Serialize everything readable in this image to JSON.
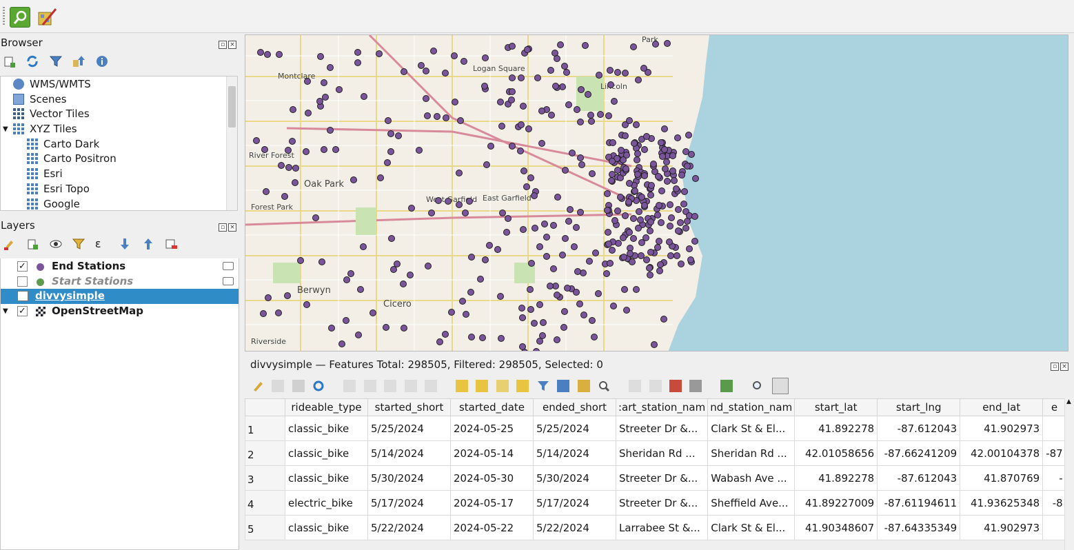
{
  "toolbar": {
    "icons": [
      "identify-icon",
      "digitize-icon"
    ]
  },
  "browser": {
    "title": "Browser",
    "items": [
      {
        "label": "WMS/WMTS",
        "icon": "globe-icon",
        "indent": 0
      },
      {
        "label": "Scenes",
        "icon": "cube-icon",
        "indent": 0
      },
      {
        "label": "Vector Tiles",
        "icon": "grid-icon",
        "indent": 0
      },
      {
        "label": "XYZ Tiles",
        "icon": "grid-icon",
        "indent": 0,
        "expanded": true
      },
      {
        "label": "Carto Dark",
        "icon": "grid-icon",
        "indent": 1
      },
      {
        "label": "Carto Positron",
        "icon": "grid-icon",
        "indent": 1
      },
      {
        "label": "Esri",
        "icon": "grid-icon",
        "indent": 1
      },
      {
        "label": "Esri Topo",
        "icon": "grid-icon",
        "indent": 1
      },
      {
        "label": "Google",
        "icon": "grid-icon",
        "indent": 1
      }
    ]
  },
  "layers": {
    "title": "Layers",
    "items": [
      {
        "label": "End Stations",
        "checked": true,
        "color": "#7b559b"
      },
      {
        "label": "Start Stations",
        "checked": false,
        "color": "#5f9b4f"
      },
      {
        "label": "divvysimple",
        "selected": true
      },
      {
        "label": "OpenStreetMap",
        "checked": true
      }
    ]
  },
  "map": {
    "labels": [
      "Montclare",
      "Logan Square",
      "River Forest",
      "Oak Park",
      "Forest Park",
      "Berwyn",
      "Cicero",
      "Riverside",
      "West Garfield",
      "East Garfield",
      "Lincoln",
      "Park"
    ]
  },
  "attribute_table": {
    "title": "divvysimple — Features Total: 298505, Filtered: 298505, Selected: 0",
    "columns": [
      "rideable_type",
      "started_short",
      "started_date",
      "ended_short",
      ":art_station_nam",
      "nd_station_nam",
      "start_lat",
      "start_lng",
      "end_lat",
      "e"
    ],
    "rows": [
      {
        "id": "1",
        "cells": [
          "classic_bike",
          "5/25/2024",
          "2024-05-25",
          "5/25/2024",
          "Streeter Dr &...",
          "Clark St & El...",
          "41.892278",
          "-87.612043",
          "41.902973",
          ""
        ]
      },
      {
        "id": "2",
        "cells": [
          "classic_bike",
          "5/14/2024",
          "2024-05-14",
          "5/14/2024",
          "Sheridan Rd ...",
          "Sheridan Rd ...",
          "42.01058656",
          "-87.66241209",
          "42.00104378",
          "-87"
        ]
      },
      {
        "id": "3",
        "cells": [
          "classic_bike",
          "5/30/2024",
          "2024-05-30",
          "5/30/2024",
          "Streeter Dr &...",
          "Wabash Ave ...",
          "41.892278",
          "-87.612043",
          "41.870769",
          "-"
        ]
      },
      {
        "id": "4",
        "cells": [
          "electric_bike",
          "5/17/2024",
          "2024-05-17",
          "5/17/2024",
          "Streeter Dr &...",
          "Sheffield Ave...",
          "41.89227009",
          "-87.61194611",
          "41.93625348",
          "-8"
        ]
      },
      {
        "id": "5",
        "cells": [
          "classic_bike",
          "5/22/2024",
          "2024-05-22",
          "5/22/2024",
          "Larrabee St &...",
          "Clark St & El...",
          "41.90348607",
          "-87.64335349",
          "41.902973",
          ""
        ]
      }
    ]
  }
}
